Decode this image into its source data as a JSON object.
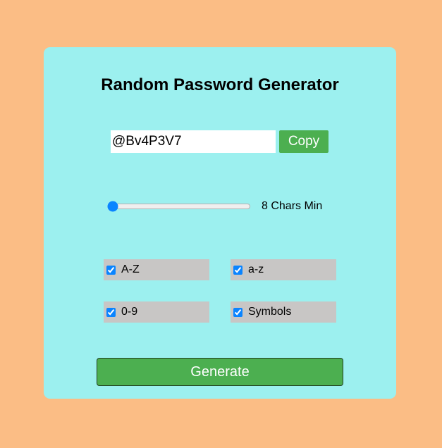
{
  "app": {
    "title": "Random Password Generator"
  },
  "password": {
    "value": "@Bv4P3V7",
    "copy_label": "Copy"
  },
  "length": {
    "value": 8,
    "min": 8,
    "max": 40,
    "label": "8 Chars Min"
  },
  "options": [
    {
      "label": "A-Z",
      "checked": true
    },
    {
      "label": "a-z",
      "checked": true
    },
    {
      "label": "0-9",
      "checked": true
    },
    {
      "label": "Symbols",
      "checked": true
    }
  ],
  "actions": {
    "generate_label": "Generate"
  },
  "colors": {
    "page_background": "#fbbd85",
    "card_background": "#9cf0ef",
    "button_green": "#4caf50",
    "option_background": "#c8c6c5"
  }
}
